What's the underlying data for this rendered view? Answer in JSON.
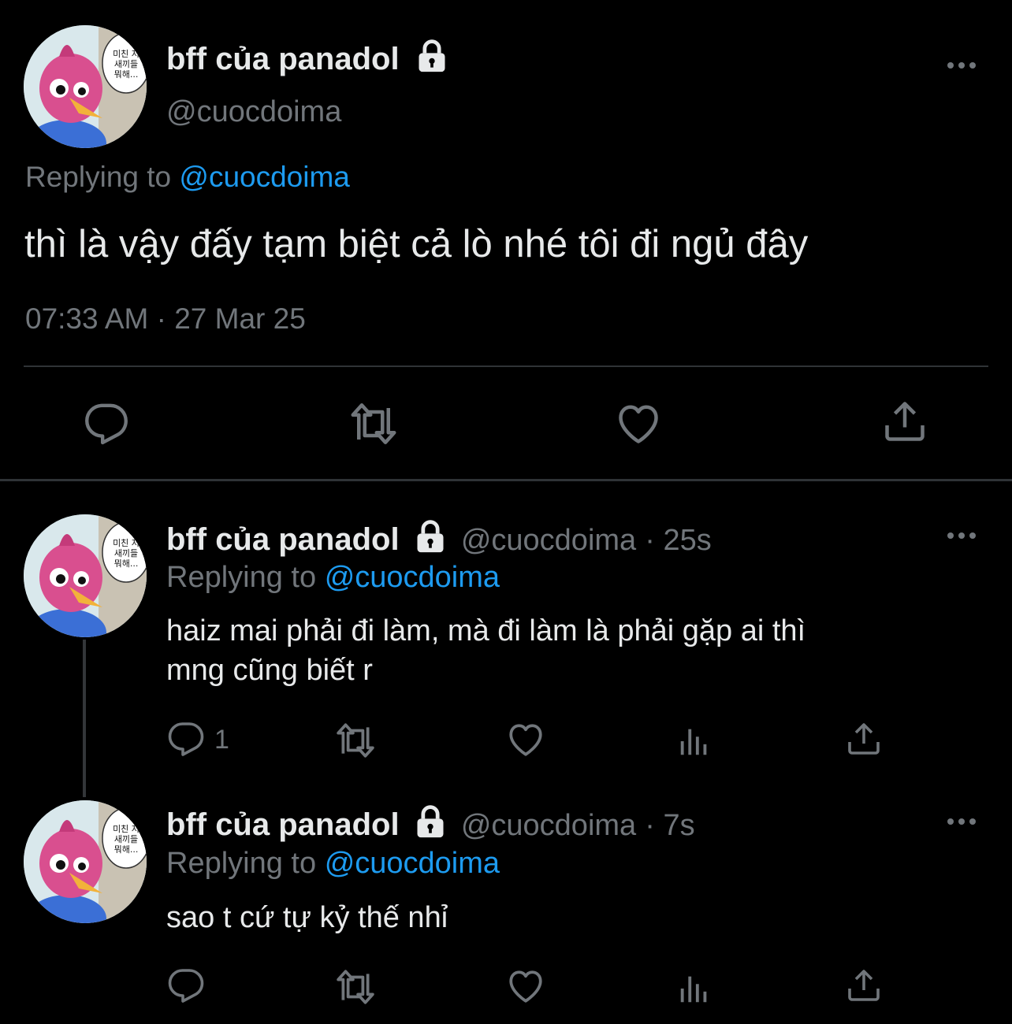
{
  "main_tweet": {
    "display_name": "bff của panadol",
    "handle": "@cuocdoima",
    "replying_prefix": "Replying to",
    "replying_to": "@cuocdoima",
    "text": "thì là vậy đấy tạm biệt cả lò nhé tôi đi ngủ đây",
    "timestamp": "07:33 AM · 27 Mar 25",
    "avatar_bubble_text": "미친 저\n새끼들\n뭐해..."
  },
  "replies": [
    {
      "display_name": "bff của panadol",
      "handle": "@cuocdoima",
      "time": "· 25s",
      "replying_prefix": "Replying to",
      "replying_to": "@cuocdoima",
      "text_line1": "haiz mai phải đi làm, mà đi làm là phải gặp ai thì",
      "text_line2": "mng cũng biết r",
      "reply_count": "1"
    },
    {
      "display_name": "bff của panadol",
      "handle": "@cuocdoima",
      "time": "· 7s",
      "replying_prefix": "Replying to",
      "replying_to": "@cuocdoima",
      "text_line1": "sao t cứ tự kỷ thế nhỉ",
      "reply_count": ""
    }
  ],
  "colors": {
    "background": "#000000",
    "text": "#e7e9ea",
    "muted": "#71767b",
    "link": "#1d9bf0",
    "divider": "#2f3336"
  },
  "icons": [
    "lock-icon",
    "more-icon",
    "reply-icon",
    "retweet-icon",
    "like-icon",
    "share-icon",
    "views-icon"
  ]
}
